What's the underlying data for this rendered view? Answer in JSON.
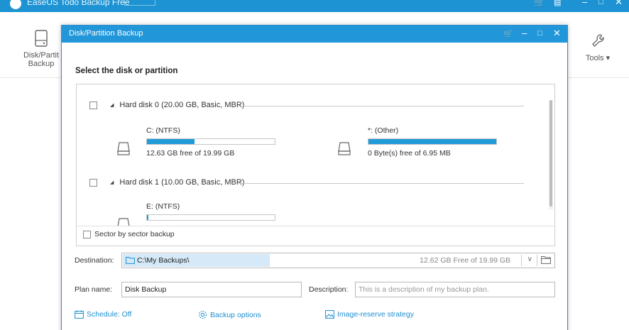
{
  "app": {
    "title": "EaseUS Todo Backup Free",
    "left_tool_label_1": "Disk/Partit",
    "left_tool_label_2": "Backup",
    "tools_label": "Tools ▾"
  },
  "dialog": {
    "title": "Disk/Partition Backup",
    "section_title": "Select the disk or partition",
    "disks": [
      {
        "label": "Hard disk 0 (20.00 GB, Basic, MBR)",
        "partitions": [
          {
            "name": "C: (NTFS)",
            "free": "12.63 GB free of 19.99 GB",
            "used_fraction": 0.37
          },
          {
            "name": "*: (Other)",
            "free": "0 Byte(s) free of 6.95 MB",
            "used_fraction": 1.0
          }
        ]
      },
      {
        "label": "Hard disk 1 (10.00 GB, Basic, MBR)",
        "partitions": [
          {
            "name": "E: (NTFS)",
            "free": "",
            "used_fraction": 0.01
          }
        ]
      }
    ],
    "sector_label": "Sector by sector backup",
    "destination": {
      "label": "Destination:",
      "path": "C:\\My Backups\\",
      "free": "12.62 GB Free of 19.99 GB"
    },
    "plan": {
      "label": "Plan name:",
      "value": "Disk Backup"
    },
    "description": {
      "label": "Description:",
      "placeholder": "This is a description of my backup plan."
    },
    "options": {
      "schedule": "Schedule: Off",
      "backup_options": "Backup options",
      "image_reserve": "Image-reserve strategy"
    }
  },
  "colors": {
    "accent": "#2196d8",
    "bar_fill": "#1f9bd7"
  }
}
